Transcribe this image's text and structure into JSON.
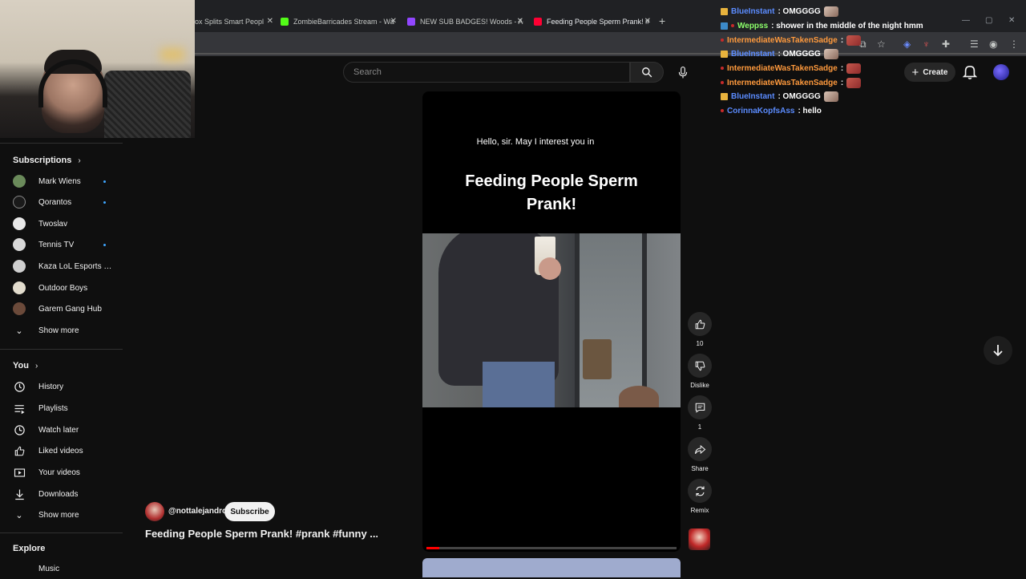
{
  "browser": {
    "tabs": [
      {
        "label": "ox Splits Smart Peopl",
        "fav": "#7aa5ff",
        "active": false
      },
      {
        "label": "ZombieBarricades Stream - Wa",
        "fav": "#53fc18",
        "active": false
      },
      {
        "label": "NEW SUB BADGES! Woods - Ac",
        "fav": "#9146ff",
        "active": false
      },
      {
        "label": "Feeding People Sperm Prank! #",
        "fav": "#ff0033",
        "active": true
      }
    ],
    "close_glyph": "✕",
    "new_tab_glyph": "+"
  },
  "header": {
    "search_placeholder": "Search",
    "search_icon": "search-icon",
    "mic_icon": "mic-icon",
    "create_label": "Create",
    "bell_icon": "bell-icon"
  },
  "sidebar": {
    "subscriptions_heading": "Subscriptions",
    "subscriptions": [
      {
        "name": "Mark Wiens",
        "color": "#6a8a5a",
        "new": true
      },
      {
        "name": "Qorantos",
        "color": "#1a1a1a",
        "new": true
      },
      {
        "name": "Twoslav",
        "color": "#e8e8e8",
        "new": false
      },
      {
        "name": "Tennis TV",
        "color": "#d9d9d9",
        "new": true
      },
      {
        "name": "Kaza LoL Esports H...",
        "color": "#cfcfcf",
        "new": false
      },
      {
        "name": "Outdoor Boys",
        "color": "#e2dccd",
        "new": false
      },
      {
        "name": "Garem Gang Hub",
        "color": "#6b4a3a",
        "new": false
      }
    ],
    "show_more_1": "Show more",
    "you_heading": "You",
    "you_items": [
      {
        "label": "History",
        "icon": "history-icon"
      },
      {
        "label": "Playlists",
        "icon": "playlists-icon"
      },
      {
        "label": "Watch later",
        "icon": "watch-later-icon"
      },
      {
        "label": "Liked videos",
        "icon": "liked-videos-icon"
      },
      {
        "label": "Your videos",
        "icon": "your-videos-icon"
      },
      {
        "label": "Downloads",
        "icon": "downloads-icon"
      }
    ],
    "show_more_2": "Show more",
    "explore_heading": "Explore",
    "explore_partial": "Music"
  },
  "short": {
    "caption": "Hello, sir. May I interest you in",
    "title_line1": "Feeding People Sperm",
    "title_line2": "Prank!",
    "progress": 0.05,
    "channel": "@nottalejandro",
    "subscribe_label": "Subscribe",
    "video_title": "Feeding People Sperm Prank! #prank #funny ..."
  },
  "actions": {
    "like_count": "10",
    "dislike_label": "Dislike",
    "comment_count": "1",
    "share_label": "Share",
    "remix_label": "Remix"
  },
  "chat": [
    {
      "user": "BlueInstant",
      "color": "#5b8cff",
      "badge": "#e8b33d",
      "msg": ": OMGGGG",
      "emote": "face"
    },
    {
      "user": "Weppss",
      "color": "#8cff6b",
      "badge": "#3c8ac8",
      "msg": ": shower in the middle of the night hmm",
      "emote": ""
    },
    {
      "user": "IntermediateWasTakenSadge",
      "color": "#ff9a3d",
      "badge": "#c72a2a",
      "msg": ":",
      "emote": "red"
    },
    {
      "user": "BlueInstant",
      "color": "#5b8cff",
      "badge": "#e8b33d",
      "msg": ": OMGGGG",
      "emote": "face"
    },
    {
      "user": "IntermediateWasTakenSadge",
      "color": "#ff9a3d",
      "badge": "#c72a2a",
      "msg": ":",
      "emote": "red"
    },
    {
      "user": "IntermediateWasTakenSadge",
      "color": "#ff9a3d",
      "badge": "#c72a2a",
      "msg": ":",
      "emote": "red"
    },
    {
      "user": "BlueInstant",
      "color": "#5b8cff",
      "badge": "#e8b33d",
      "msg": ": OMGGGG",
      "emote": "face"
    },
    {
      "user": "CorinnaKopfsAss",
      "color": "#5b8cff",
      "badge": "#c72a2a",
      "msg": ": hello",
      "emote": ""
    }
  ]
}
